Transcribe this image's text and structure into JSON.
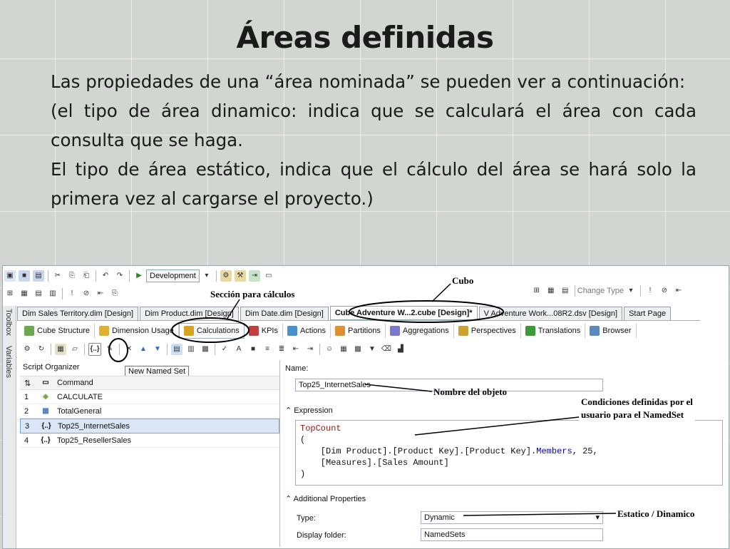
{
  "slide": {
    "title": "Áreas definidas",
    "paragraphs": [
      "Las propiedades de una “área nominada” se pueden ver a continuación:",
      "(el tipo de área dinamico: indica que se calculará el área con cada consulta que se haga.",
      "El tipo de área estático, indica que el cálculo del área se hará solo la primera vez al cargarse el proyecto.)"
    ]
  },
  "toolbar": {
    "config_dropdown": "Development",
    "change_type": "Change Type"
  },
  "doc_tabs": [
    "Dim Sales Territory.dim [Design]",
    "Dim Product.dim [Design]",
    "Dim Date.dim [Design]",
    "Cube Adventure W...2.cube [Design]*",
    "V Adventure Work...08R2.dsv [Design]",
    "Start Page"
  ],
  "side": {
    "toolbox": "Toolbox",
    "variables": "Variables"
  },
  "design_tabs": [
    {
      "label": "Cube Structure",
      "color": "#6aa84f"
    },
    {
      "label": "Dimension Usage",
      "color": "#e0b030"
    },
    {
      "label": "Calculations",
      "color": "#d9a520"
    },
    {
      "label": "KPIs",
      "color": "#c04040"
    },
    {
      "label": "Actions",
      "color": "#4a8fd0"
    },
    {
      "label": "Partitions",
      "color": "#e09030"
    },
    {
      "label": "Aggregations",
      "color": "#7a7acc"
    },
    {
      "label": "Perspectives",
      "color": "#d0a030"
    },
    {
      "label": "Translations",
      "color": "#3a9a3a"
    },
    {
      "label": "Browser",
      "color": "#5a8ac0"
    }
  ],
  "tooltip": "New Named Set",
  "organizer": {
    "title": "Script Organizer",
    "header": "Command",
    "rows": [
      {
        "num": "1",
        "icon": "cube",
        "label": "CALCULATE",
        "selected": false
      },
      {
        "num": "2",
        "icon": "calc",
        "label": "TotalGeneral",
        "selected": false
      },
      {
        "num": "3",
        "icon": "{..}",
        "label": "Top25_InternetSales",
        "selected": true
      },
      {
        "num": "4",
        "icon": "{..}",
        "label": "Top25_ResellerSales",
        "selected": false
      }
    ]
  },
  "properties": {
    "name_label": "Name:",
    "name_value": "Top25_InternetSales",
    "expression_label": "Expression",
    "expression_lines": {
      "l1": "TopCount",
      "l2": "(",
      "l3a": "    [Dim Product].[Product Key].[Product Key].",
      "l3b": "Members",
      "l3c": ", 25,",
      "l4": "    [Measures].[Sales Amount]",
      "l5": ")"
    },
    "additional_label": "Additional Properties",
    "type_label": "Type:",
    "type_value": "Dynamic",
    "folder_label": "Display folder:",
    "folder_value": "NamedSets"
  },
  "annotations": {
    "cubo": "Cubo",
    "seccion": "Sección para cálculos",
    "nombre": "Nombre del objeto",
    "condiciones_1": "Condiciones definidas por el",
    "condiciones_2": "usuario para el NamedSet",
    "estatico": "Estatico / Dinamico"
  }
}
